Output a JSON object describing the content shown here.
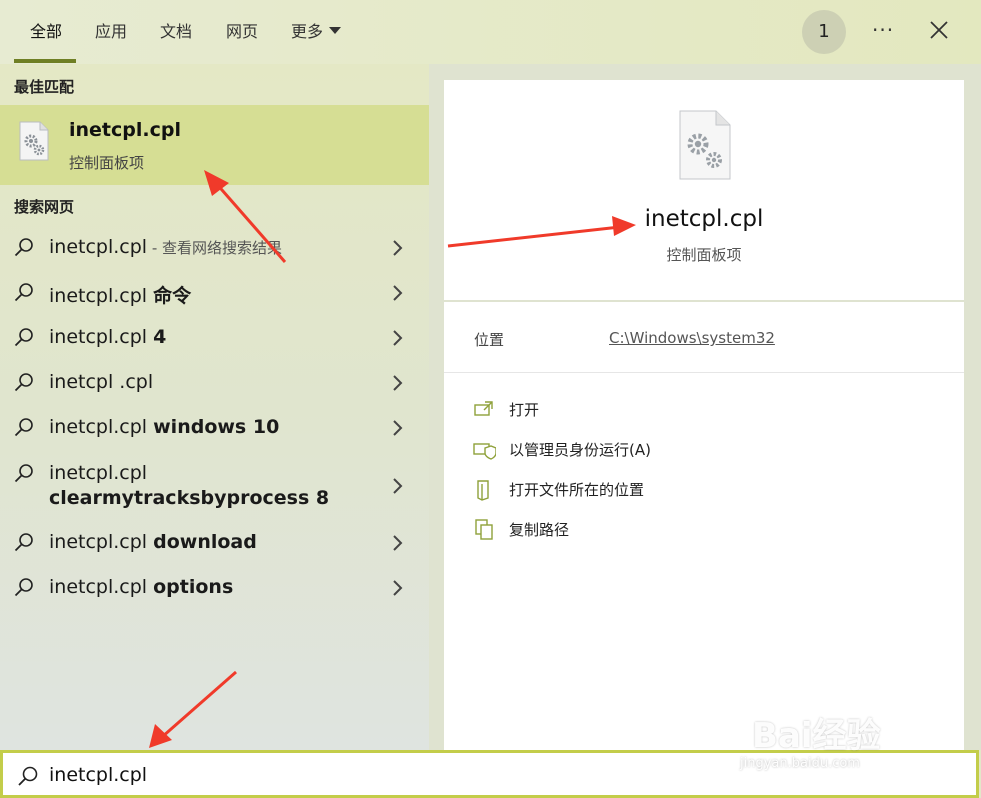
{
  "tabs": [
    {
      "label": "全部"
    },
    {
      "label": "应用"
    },
    {
      "label": "文档"
    },
    {
      "label": "网页"
    },
    {
      "label": "更多"
    }
  ],
  "header": {
    "badge": "1",
    "more_icon": "ellipsis-icon",
    "close_icon": "close-icon"
  },
  "left": {
    "best_match_title": "最佳匹配",
    "best_match": {
      "name": "inetcpl.cpl",
      "subtitle": "控制面板项",
      "icon": "settings-file-icon"
    },
    "web_title": "搜索网页",
    "web_results": [
      {
        "prefix": "inetcpl.cpl",
        "bold": "",
        "hint": " - 查看网络搜索结果"
      },
      {
        "prefix": "inetcpl.cpl ",
        "bold": "命令",
        "hint": ""
      },
      {
        "prefix": "inetcpl.cpl ",
        "bold": "4",
        "hint": ""
      },
      {
        "prefix": "inetcpl .cpl",
        "bold": "",
        "hint": ""
      },
      {
        "prefix": "inetcpl.cpl ",
        "bold": "windows 10",
        "hint": ""
      },
      {
        "prefix": "inetcpl.cpl",
        "bold": "clearmytracksbyprocess 8",
        "hint": ""
      },
      {
        "prefix": "inetcpl.cpl ",
        "bold": "download",
        "hint": ""
      },
      {
        "prefix": "inetcpl.cpl ",
        "bold": "options",
        "hint": ""
      }
    ]
  },
  "detail": {
    "name": "inetcpl.cpl",
    "subtitle": "控制面板项",
    "location_label": "位置",
    "location_value": "C:\\Windows\\system32",
    "actions": [
      {
        "label": "打开",
        "icon": "open-icon"
      },
      {
        "label": "以管理员身份运行(A)",
        "icon": "shield-icon"
      },
      {
        "label": "打开文件所在的位置",
        "icon": "folder-icon"
      },
      {
        "label": "复制路径",
        "icon": "copy-icon"
      }
    ]
  },
  "search": {
    "value": "inetcpl.cpl"
  },
  "watermark": {
    "text": "Bai经验",
    "url": "jingyan.baidu.com"
  },
  "colors": {
    "accent": "#6f7f24",
    "selection": "#d6de94",
    "searchbox_border": "#c3cd4a",
    "arrow": "#f03a2a"
  }
}
